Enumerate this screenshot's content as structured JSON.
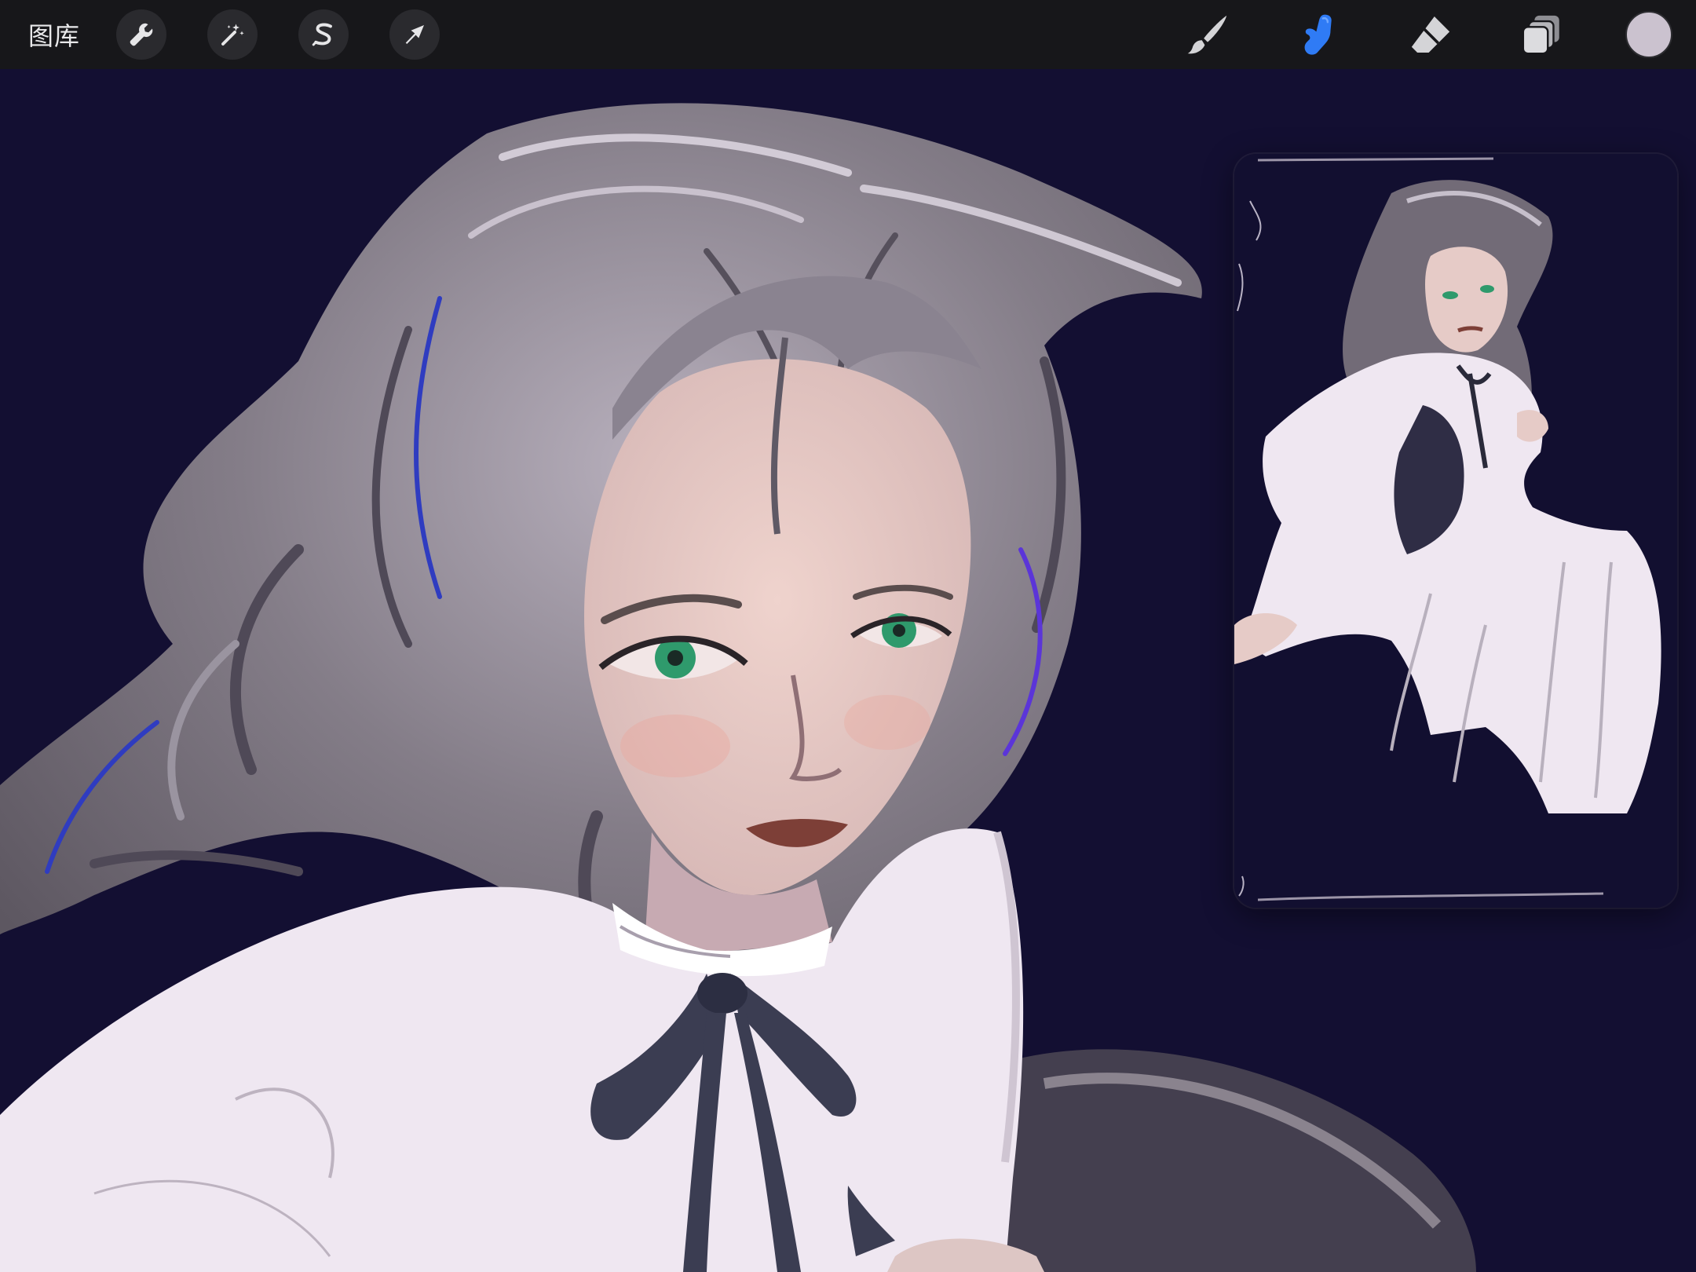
{
  "toolbar": {
    "gallery_label": "图库",
    "left_tools": [
      {
        "name": "actions",
        "icon": "wrench-icon"
      },
      {
        "name": "adjustments",
        "icon": "magic-wand-icon"
      },
      {
        "name": "selection",
        "icon": "selection-s-icon"
      },
      {
        "name": "transform",
        "icon": "arrow-cursor-icon"
      }
    ],
    "right_tools": [
      {
        "name": "brush",
        "icon": "brush-icon",
        "active": false
      },
      {
        "name": "smudge",
        "icon": "smudge-finger-icon",
        "active": true
      },
      {
        "name": "eraser",
        "icon": "eraser-icon",
        "active": false
      },
      {
        "name": "layers",
        "icon": "layers-icon",
        "active": false
      }
    ],
    "current_color": "#cbc2cf",
    "active_tool_color": "#2f7bf5"
  },
  "colors": {
    "canvas_background": "#130f32",
    "toolbar_background": "#17171a",
    "hair": "#6c6670",
    "skin": "#e7c8c3",
    "shirt": "#efe7f1",
    "ribbon": "#3b3d52",
    "eyes": "#2f9a6c",
    "lips": "#7d3f37"
  }
}
